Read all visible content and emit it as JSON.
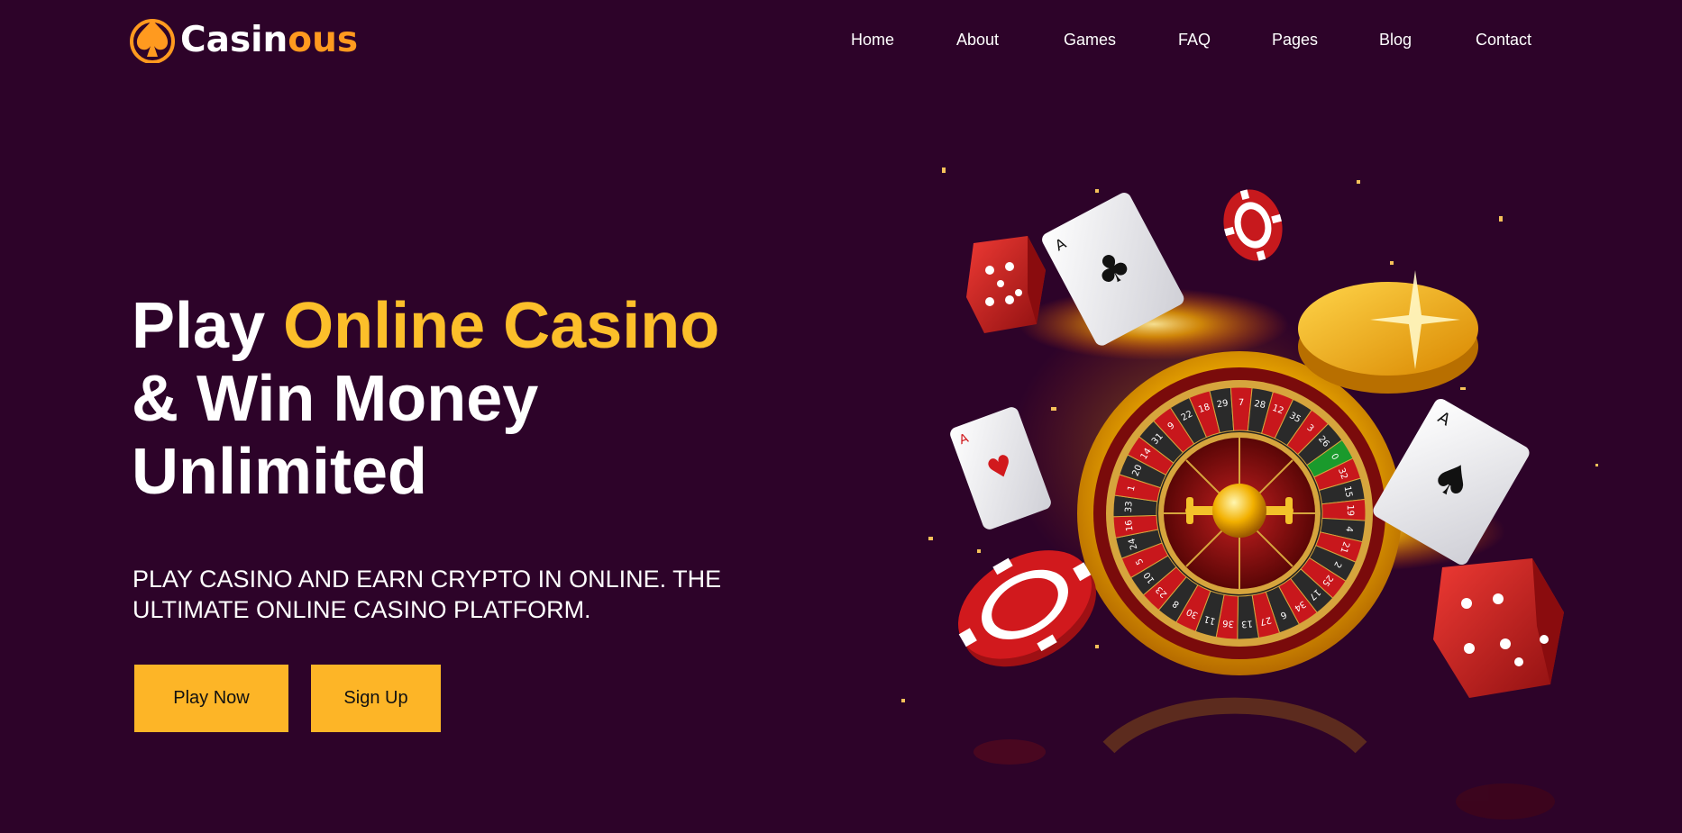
{
  "brand": {
    "name_part1": "Casin",
    "name_part2": "ous",
    "logo_icon": "spade-icon",
    "colors": {
      "accent": "#ff9a1f",
      "gold": "#fcbf2a",
      "background": "#2d0329",
      "button": "#fdb527"
    }
  },
  "nav": {
    "items": [
      {
        "label": "Home"
      },
      {
        "label": "About"
      },
      {
        "label": "Games"
      },
      {
        "label": "FAQ"
      },
      {
        "label": "Pages"
      },
      {
        "label": "Blog"
      },
      {
        "label": "Contact"
      }
    ]
  },
  "hero": {
    "headline_word1": "Play",
    "headline_accent": "Online Casino",
    "headline_line2": "& Win Money",
    "headline_line3": "Unlimited",
    "subtitle": "PLAY CASINO AND EARN CRYPTO IN ONLINE. THE ULTIMATE ONLINE CASINO PLATFORM.",
    "play_button": "Play Now",
    "signup_button": "Sign Up"
  },
  "illustration": {
    "roulette_numbers": [
      "0",
      "32",
      "15",
      "19",
      "4",
      "21",
      "2",
      "25",
      "17",
      "34",
      "6",
      "27",
      "13",
      "36",
      "11",
      "30",
      "8",
      "23",
      "10",
      "5",
      "24",
      "16",
      "33",
      "1",
      "20",
      "14",
      "31",
      "9",
      "22",
      "18",
      "29",
      "7",
      "28",
      "12",
      "35",
      "3",
      "26"
    ],
    "card_ranks": [
      "A",
      "A",
      "A"
    ],
    "items": [
      "roulette-wheel",
      "gold-coin",
      "poker-chip",
      "dice",
      "playing-card"
    ]
  }
}
